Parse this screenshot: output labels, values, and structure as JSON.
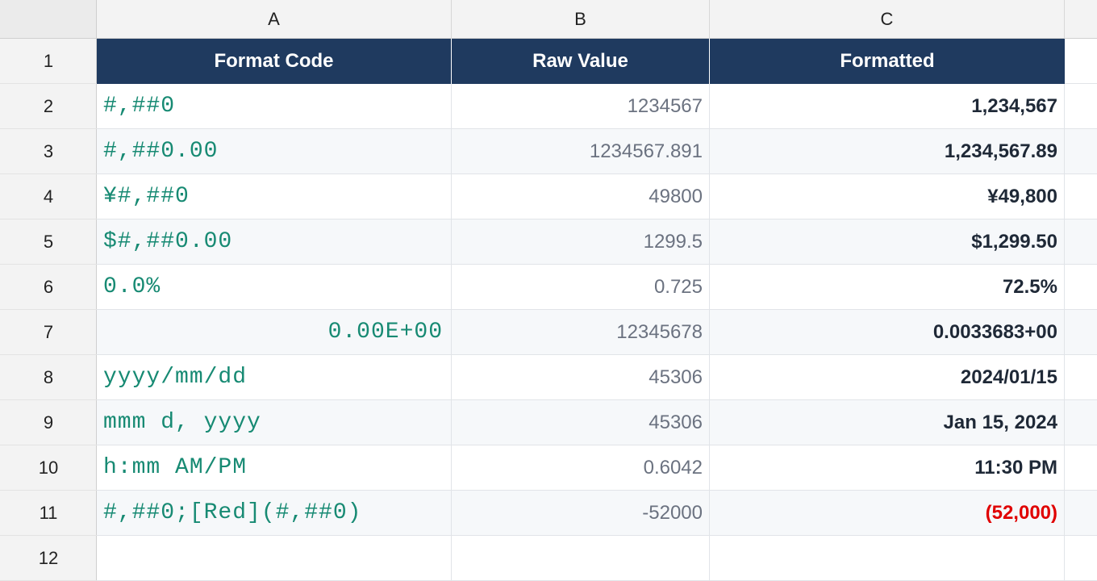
{
  "columns": [
    "A",
    "B",
    "C"
  ],
  "row_numbers": [
    "1",
    "2",
    "3",
    "4",
    "5",
    "6",
    "7",
    "8",
    "9",
    "10",
    "11",
    "12"
  ],
  "header": {
    "format_code": "Format Code",
    "raw_value": "Raw Value",
    "formatted": "Formatted"
  },
  "rows": [
    {
      "code": "#,##0",
      "raw": "1234567",
      "formatted": "1,234,567"
    },
    {
      "code": "#,##0.00",
      "raw": "1234567.891",
      "formatted": "1,234,567.89"
    },
    {
      "code": "¥#,##0",
      "raw": "49800",
      "formatted": "¥49,800"
    },
    {
      "code": "$#,##0.00",
      "raw": "1299.5",
      "formatted": "$1,299.50"
    },
    {
      "code": "0.0%",
      "raw": "0.725",
      "formatted": "72.5%"
    },
    {
      "code": "0.00E+00",
      "raw": "12345678",
      "formatted": "0.0033683+00"
    },
    {
      "code": "yyyy/mm/dd",
      "raw": "45306",
      "formatted": "2024/01/15"
    },
    {
      "code": "mmm d, yyyy",
      "raw": "45306",
      "formatted": "Jan 15, 2024"
    },
    {
      "code": "h:mm AM/PM",
      "raw": "0.6042",
      "formatted": "11:30 PM"
    },
    {
      "code": "#,##0;[Red](#,##0)",
      "raw": "-52000",
      "formatted": "(52,000)"
    }
  ],
  "colors": {
    "header_bg": "#1f3a5f",
    "code_text": "#178a73",
    "negative_text": "#e00000"
  }
}
